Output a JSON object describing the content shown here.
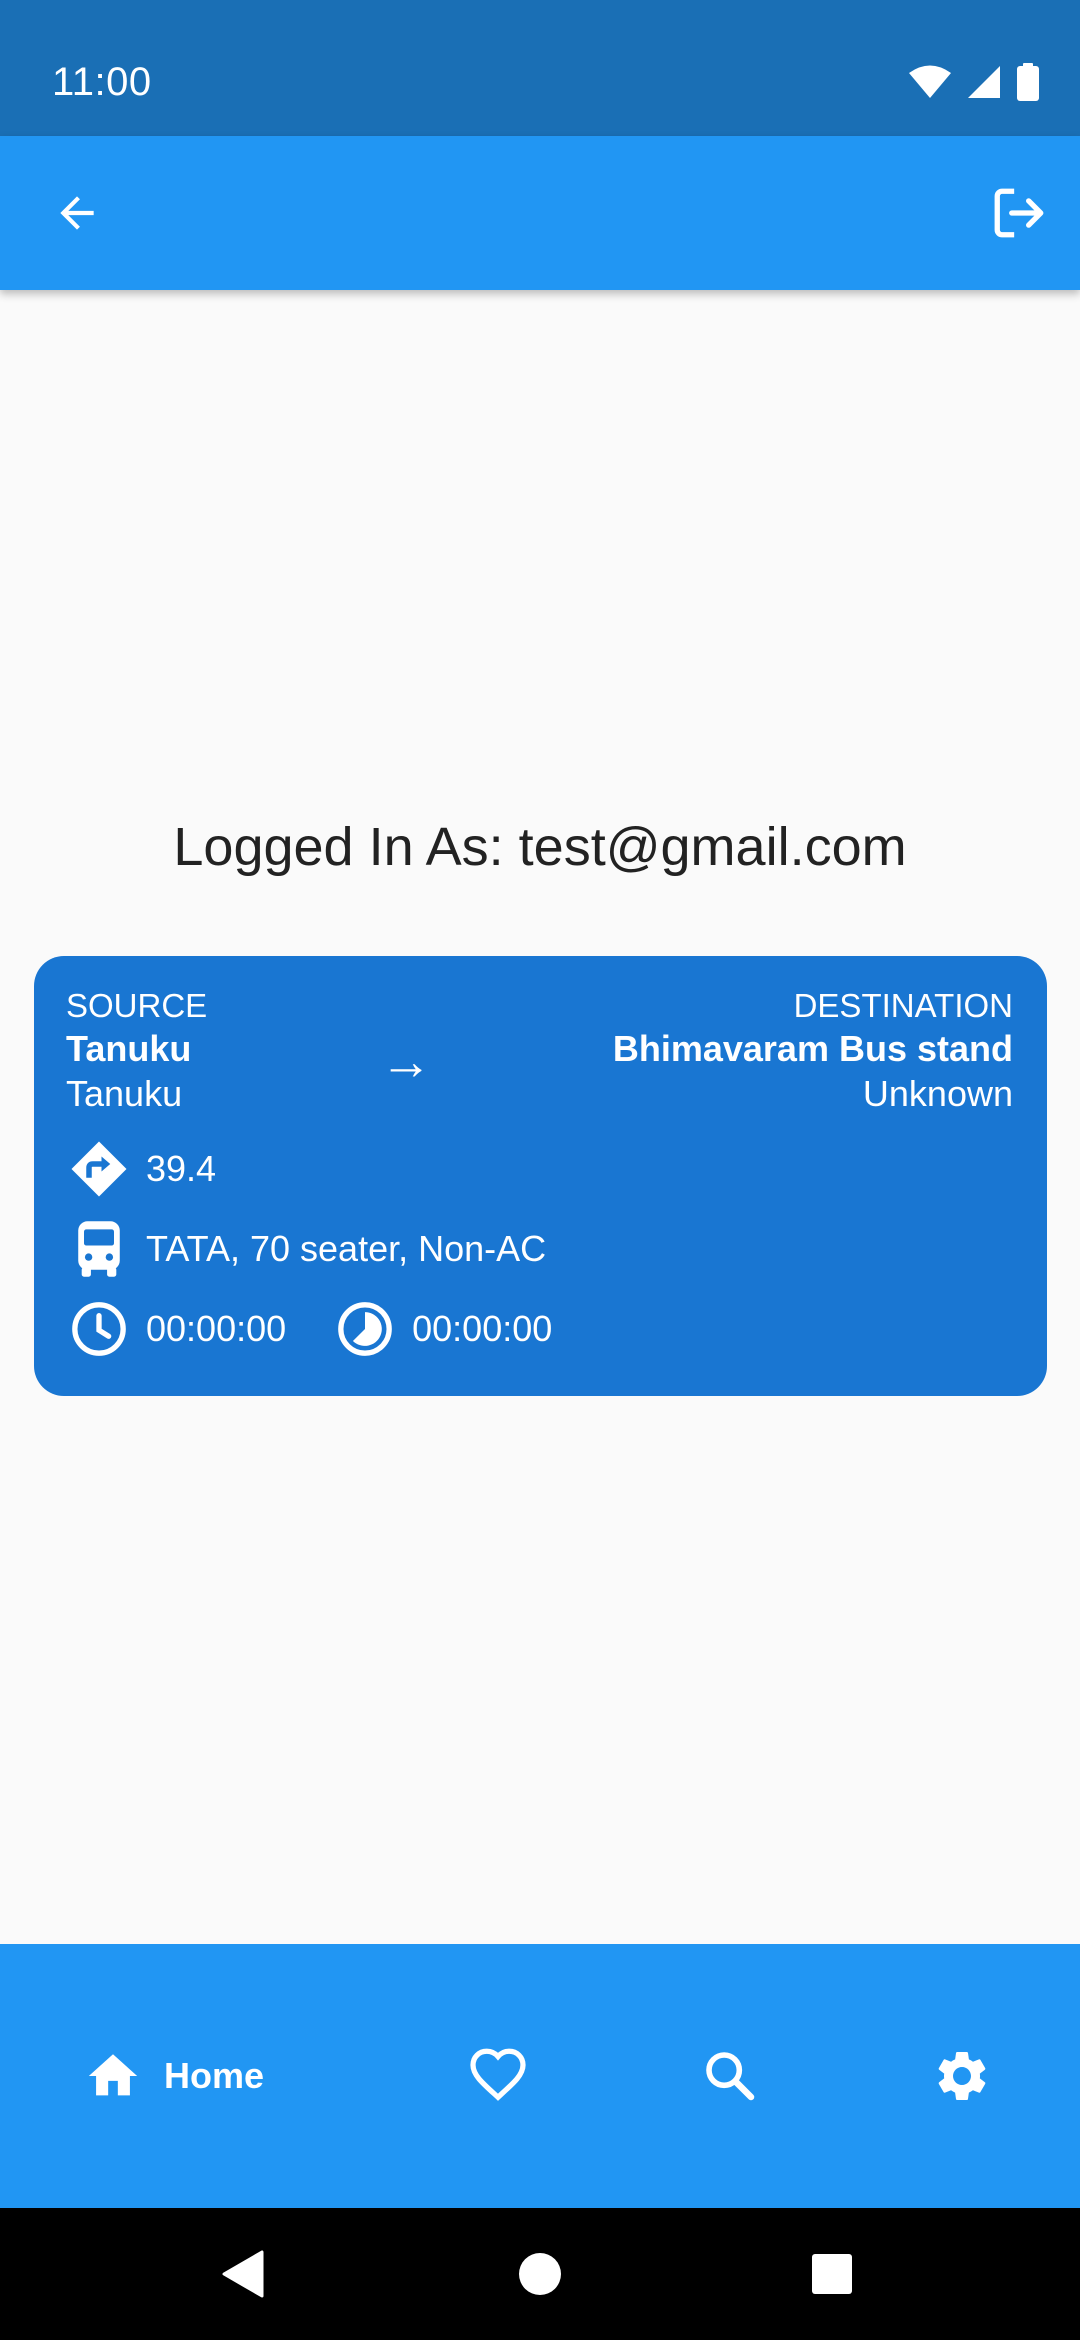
{
  "status_bar": {
    "time": "11:00",
    "icons": [
      "wifi-icon",
      "signal-icon",
      "battery-icon"
    ]
  },
  "app_bar": {
    "back_icon": "arrow-back-icon",
    "logout_icon": "logout-icon"
  },
  "main": {
    "logged_in_text": "Logged In As: test@gmail.com"
  },
  "trip_card": {
    "source_caption": "SOURCE",
    "source_name": "Tanuku",
    "source_sub": "Tanuku",
    "arrow": "→",
    "destination_caption": "DESTINATION",
    "destination_name": "Bhimavaram Bus stand",
    "destination_sub": "Unknown",
    "distance": "39.4",
    "bus": "TATA, 70 seater, Non-AC",
    "start_time": "00:00:00",
    "duration": "00:00:00",
    "card_color": "#1976D2"
  },
  "bottom_nav": {
    "items": [
      {
        "label": "Home",
        "icon": "home-icon",
        "selected": true
      },
      {
        "label": "",
        "icon": "heart-icon",
        "selected": false
      },
      {
        "label": "",
        "icon": "search-icon",
        "selected": false
      },
      {
        "label": "",
        "icon": "gear-icon",
        "selected": false
      }
    ]
  },
  "colors": {
    "status_bar": "#1A6FB5",
    "primary": "#2196F3",
    "background": "#FAFAFA"
  }
}
